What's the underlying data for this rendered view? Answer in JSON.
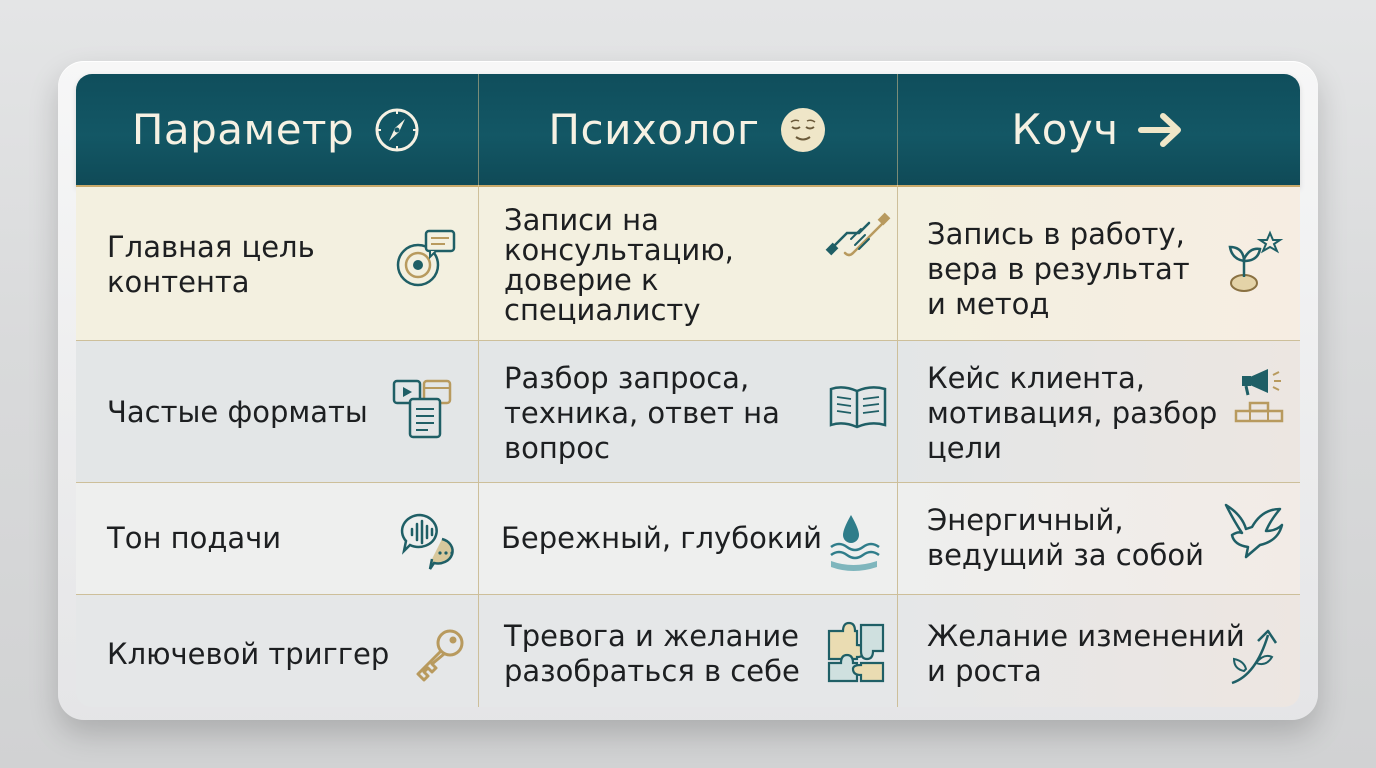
{
  "header": {
    "param": {
      "label": "Параметр",
      "icon": "compass-icon"
    },
    "psych": {
      "label": "Психолог",
      "icon": "calm-face-icon"
    },
    "coach": {
      "label": "Коуч",
      "icon": "arrow-right-icon"
    }
  },
  "rows": [
    {
      "param": {
        "text": "Главная цель\nконтента",
        "icon": "target-chat-icon"
      },
      "psych": {
        "text": "Записи на\nконсультацию,\nдоверие к\nспециалисту",
        "icon": "handshake-icon"
      },
      "coach": {
        "text": "Запись в работу,\nвера в результат\nи метод",
        "icon": "sprout-star-icon"
      }
    },
    {
      "param": {
        "text": "Частые форматы",
        "icon": "media-formats-icon"
      },
      "psych": {
        "text": "Разбор запроса,\nтехника, ответ на\nвопрос",
        "icon": "open-book-icon"
      },
      "coach": {
        "text": "Кейс клиента,\nмотивация, разбор\nцели",
        "icon": "megaphone-podium-icon"
      }
    },
    {
      "param": {
        "text": "Тон подачи",
        "icon": "voice-bubbles-icon"
      },
      "psych": {
        "text": "Бережный, глубокий",
        "icon": "water-drop-icon"
      },
      "coach": {
        "text": "Энергичный,\nведущий за собой",
        "icon": "dove-icon"
      }
    },
    {
      "param": {
        "text": "Ключевой триггер",
        "icon": "key-icon"
      },
      "psych": {
        "text": "Тревога и желание\nразобраться в себе",
        "icon": "puzzle-icon"
      },
      "coach": {
        "text": "Желание изменений\nи роста",
        "icon": "growth-arrow-icon"
      }
    }
  ],
  "colors": {
    "header_bg": "#135765",
    "header_text": "#f6f1e3",
    "accent": "#c9a96a",
    "icon_teal": "#1f5f66"
  }
}
